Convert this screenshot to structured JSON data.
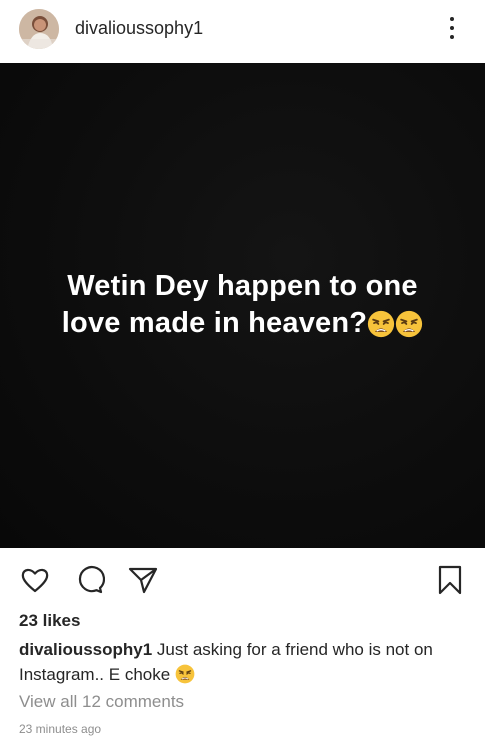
{
  "header": {
    "username": "divalioussophy1"
  },
  "post": {
    "image_text_line1": "Wetin Dey happen to one",
    "image_text_line2": "love made in heaven?"
  },
  "engagement": {
    "likes": "23 likes",
    "caption_user": "divalioussophy1",
    "caption_text": " Just asking for a friend who is not on Instagram.. E choke ",
    "view_comments": "View all 12 comments",
    "timestamp": "23 minutes ago"
  },
  "icons": {
    "like": "heart-icon",
    "comment": "comment-icon",
    "share": "paper-plane-icon",
    "save": "bookmark-icon",
    "more": "more-vertical-icon",
    "emoji": "weary-face-emoji"
  }
}
